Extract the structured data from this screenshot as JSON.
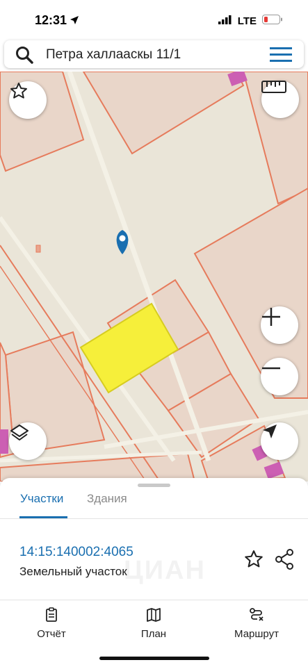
{
  "status_bar": {
    "time": "12:31",
    "network": "LTE"
  },
  "search": {
    "query": "Петра халлааскы 11/1"
  },
  "map": {
    "colors": {
      "background": "#eae5d8",
      "parcel_fill": "#e9d6c9",
      "parcel_border": "#e67b5c",
      "selected_fill": "#f6ef3a",
      "marker": "#1a6fb0",
      "building": "#cc5fb3"
    }
  },
  "sheet": {
    "tabs": [
      {
        "label": "Участки",
        "active": true
      },
      {
        "label": "Здания",
        "active": false
      }
    ],
    "parcel": {
      "id": "14:15:140002:4065",
      "type": "Земельный участок"
    },
    "watermark": "ЦИАН"
  },
  "bottom_nav": [
    {
      "label": "Отчёт",
      "icon": "report-icon"
    },
    {
      "label": "План",
      "icon": "map-plan-icon"
    },
    {
      "label": "Маршрут",
      "icon": "route-icon"
    }
  ],
  "accent_color": "#1a6fb0"
}
